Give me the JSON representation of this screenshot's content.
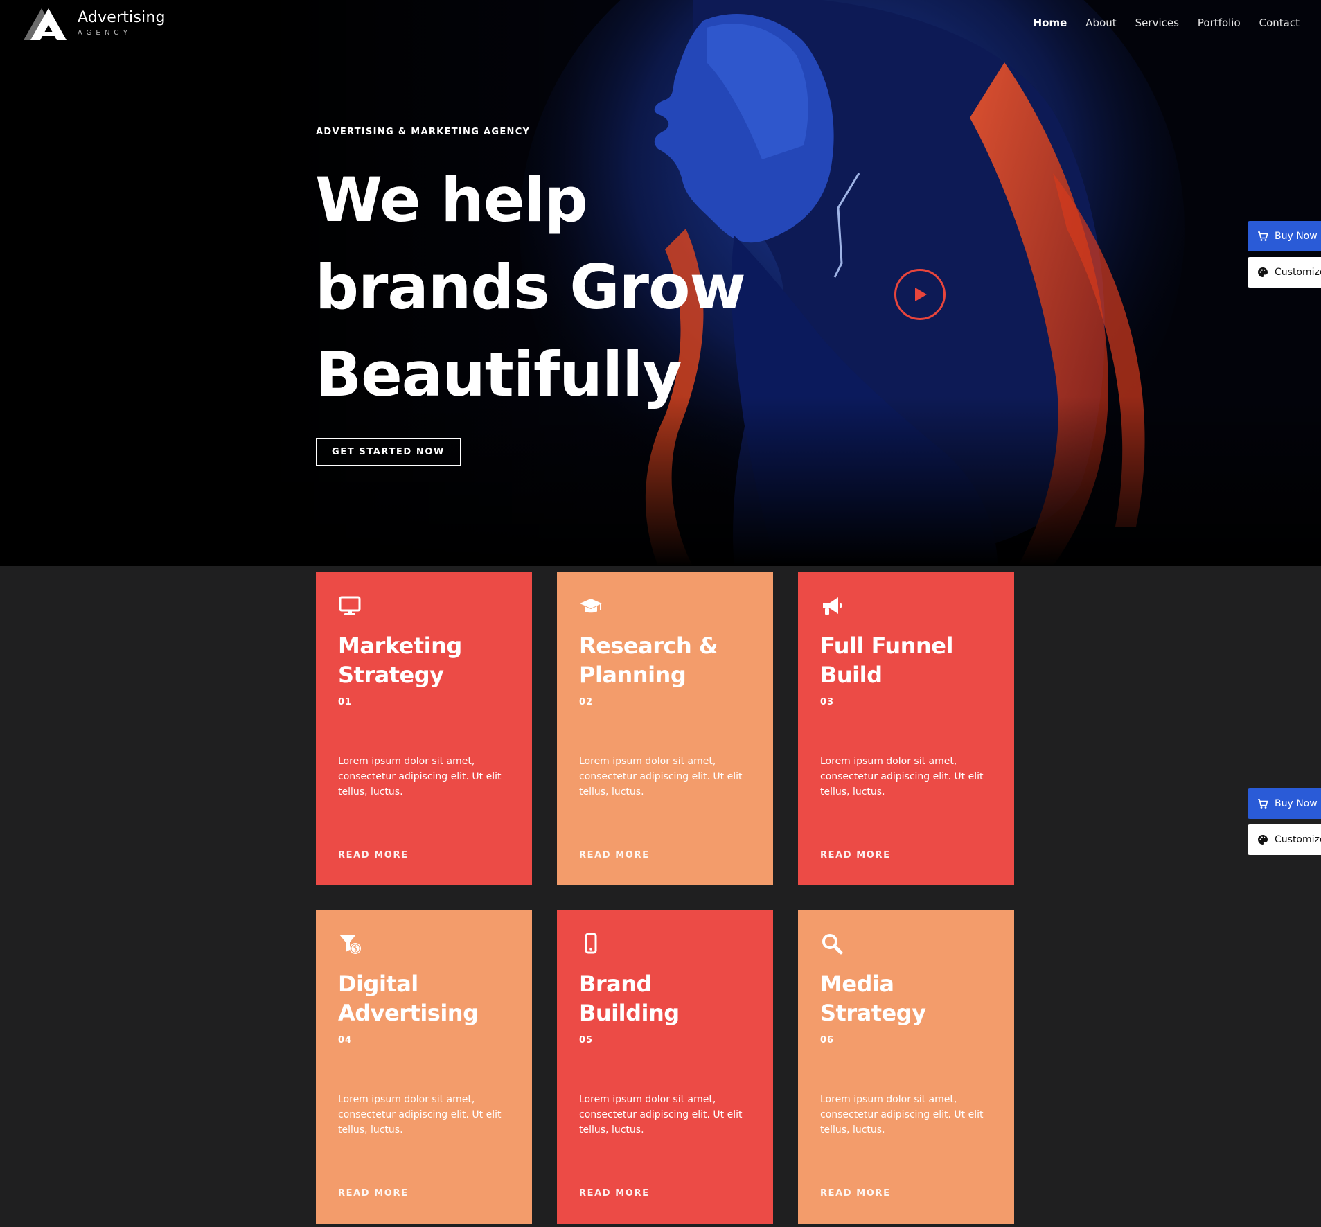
{
  "header": {
    "logo_title": "Advertising",
    "logo_subtitle": "AGENCY",
    "nav": [
      {
        "label": "Home",
        "active": true
      },
      {
        "label": "About",
        "active": false
      },
      {
        "label": "Services",
        "active": false
      },
      {
        "label": "Portfolio",
        "active": false
      },
      {
        "label": "Contact",
        "active": false
      }
    ]
  },
  "hero": {
    "eyebrow": "ADVERTISING & MARKETING AGENCY",
    "headline_lines": [
      "We help",
      "brands Grow",
      "Beautifully"
    ],
    "cta_label": "GET STARTED NOW",
    "play_icon": "play-icon"
  },
  "side_widgets": [
    {
      "buy_label": "Buy Now",
      "customize_label": "Customize"
    },
    {
      "buy_label": "Buy Now",
      "customize_label": "Customize"
    }
  ],
  "services": [
    {
      "title_lines": [
        "Marketing",
        "Strategy"
      ],
      "number": "01",
      "icon": "monitor-icon",
      "color": "red",
      "text": "Lorem ipsum dolor sit amet, consectetur adipiscing elit. Ut elit tellus, luctus.",
      "link_label": "READ MORE"
    },
    {
      "title_lines": [
        "Research &",
        "Planning"
      ],
      "number": "02",
      "icon": "graduation-cap-icon",
      "color": "orange",
      "text": "Lorem ipsum dolor sit amet, consectetur adipiscing elit. Ut elit tellus, luctus.",
      "link_label": "READ MORE"
    },
    {
      "title_lines": [
        "Full Funnel",
        "Build"
      ],
      "number": "03",
      "icon": "megaphone-icon",
      "color": "red",
      "text": "Lorem ipsum dolor sit amet, consectetur adipiscing elit. Ut elit tellus, luctus.",
      "link_label": "READ MORE"
    },
    {
      "title_lines": [
        "Digital",
        "Advertising"
      ],
      "number": "04",
      "icon": "funnel-dollar-icon",
      "color": "orange",
      "text": "Lorem ipsum dolor sit amet, consectetur adipiscing elit. Ut elit tellus, luctus.",
      "link_label": "READ MORE"
    },
    {
      "title_lines": [
        "Brand",
        "Building"
      ],
      "number": "05",
      "icon": "mobile-icon",
      "color": "red",
      "text": "Lorem ipsum dolor sit amet, consectetur adipiscing elit. Ut elit tellus, luctus.",
      "link_label": "READ MORE"
    },
    {
      "title_lines": [
        "Media",
        "Strategy"
      ],
      "number": "06",
      "icon": "search-icon",
      "color": "orange",
      "text": "Lorem ipsum dolor sit amet, consectetur adipiscing elit. Ut elit tellus, luctus.",
      "link_label": "READ MORE"
    }
  ],
  "colors": {
    "card_red": "#ec4b46",
    "card_orange": "#f39c6b",
    "play_accent": "#e8453c",
    "buy_button": "#2a5bd7",
    "page_bg": "#1f1f20",
    "hero_bg": "#000000"
  }
}
